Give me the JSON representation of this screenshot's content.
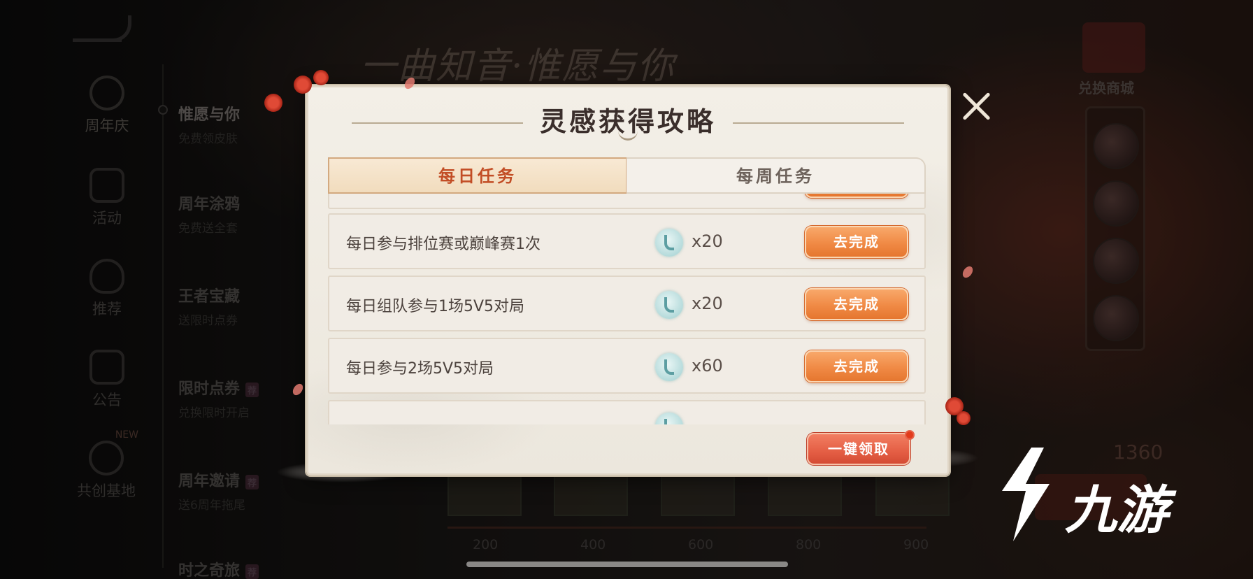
{
  "background": {
    "event_title": "一曲知音·惟愿与你",
    "left_nav": [
      {
        "label": "周年庆",
        "icon": "anniversary-icon",
        "active": true,
        "badge": ""
      },
      {
        "label": "活动",
        "icon": "gift-icon",
        "active": false,
        "badge": ""
      },
      {
        "label": "推荐",
        "icon": "flame-icon",
        "active": false,
        "badge": ""
      },
      {
        "label": "公告",
        "icon": "notice-icon",
        "active": false,
        "badge": ""
      },
      {
        "label": "共创基地",
        "icon": "co-create-icon",
        "active": false,
        "badge": "NEW"
      }
    ],
    "menu": [
      {
        "title": "惟愿与你",
        "subtitle": "免费领皮肤",
        "tag": ""
      },
      {
        "title": "周年涂鸦",
        "subtitle": "免费送全套",
        "tag": ""
      },
      {
        "title": "王者宝藏",
        "subtitle": "送限时点券",
        "tag": ""
      },
      {
        "title": "限时点券",
        "subtitle": "兑换限时开启",
        "tag": "荐"
      },
      {
        "title": "周年邀请",
        "subtitle": "送6周年拖尾",
        "tag": "荐"
      },
      {
        "title": "时之奇旅",
        "subtitle": "",
        "tag": "荐"
      }
    ],
    "shop_label": "兑换商城",
    "points": "1360",
    "milestones": [
      "200",
      "400",
      "600",
      "800",
      "900"
    ]
  },
  "modal": {
    "title": "灵感获得攻略",
    "tabs": [
      {
        "label": "每日任务",
        "active": true
      },
      {
        "label": "每周任务",
        "active": false
      }
    ],
    "tasks": [
      {
        "name": "每日参与排位赛或巅峰赛1次",
        "reward": "x20",
        "action": "去完成"
      },
      {
        "name": "每日组队参与1场5V5对局",
        "reward": "x20",
        "action": "去完成"
      },
      {
        "name": "每日参与2场5V5对局",
        "reward": "x60",
        "action": "去完成"
      }
    ],
    "claim_all": "一键领取"
  },
  "watermark": {
    "text": "九游"
  },
  "colors": {
    "accent": "#f08a45",
    "claim": "#e45e44",
    "tab_active_text": "#c24d25",
    "panel": "#f1ece5"
  }
}
